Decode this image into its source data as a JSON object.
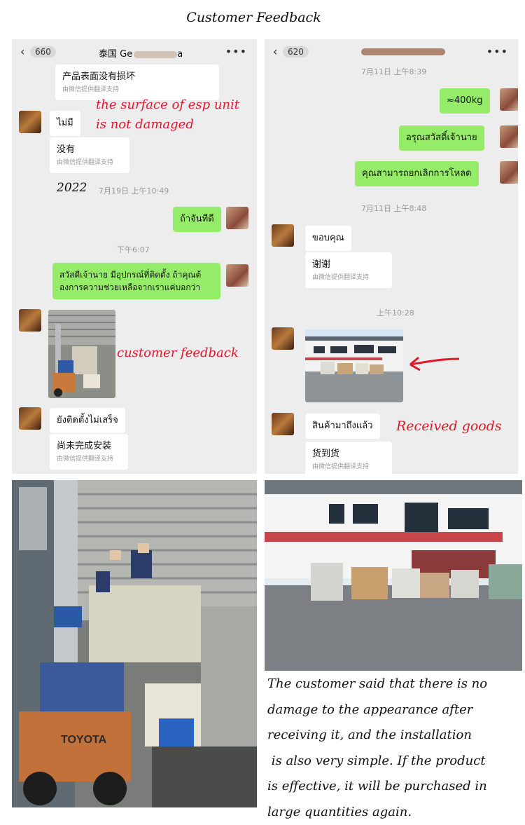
{
  "page_title": "Customer Feedback",
  "left_chat": {
    "back_count": "660",
    "title_prefix": "泰国 Ge",
    "title_suffix": "a",
    "msg1": "产品表面没有损坏",
    "translate_note": "由微信提供翻译支持",
    "annotation_surface": [
      "the surface of esp unit",
      "is not damaged"
    ],
    "msg_thai1": "ไม่มี",
    "msg_cn1": "没有",
    "year": "2022",
    "time1": "7月19日 上午10:49",
    "msg_right1": "ถ้าจันทีดี",
    "time2": "下午6:07",
    "msg_right2": [
      "สวัสดีเจ้านาย มีอุปกรณ์ที่ติดตั้ง ถ้าคุณต้",
      "องการความช่วยเหลือจากเราแค่บอกว่า"
    ],
    "annotation_feedback": "customer feedback",
    "msg_thai2": "ยังติดตั้งไม่เสร็จ",
    "msg_cn2": "尚未完成安装"
  },
  "right_chat": {
    "back_count": "620",
    "time1": "7月11日 上午8:39",
    "msg_r1": "≈400kg",
    "msg_r2": "อรุณสวัสดิ์เจ้านาย",
    "msg_r3": "คุณสามารถยกเลิกการโหลด",
    "time2": "7月11日 上午8:48",
    "msg_l1": "ขอบคุณ",
    "msg_l2": "谢谢",
    "translate_note": "由微信提供翻译支持",
    "time3": "上午10:28",
    "msg_l3": "สินค้ามาถึงแล้ว",
    "annotation_received": "Received goods",
    "msg_l4": "货到货"
  },
  "forklift_text": "TOYOTA",
  "description_lines": [
    "The customer said that there is no",
    "damage to the appearance after",
    "receiving it, and the installation",
    " is also very simple. If the product",
    "is effective, it will be purchased in",
    "large quantities again."
  ]
}
